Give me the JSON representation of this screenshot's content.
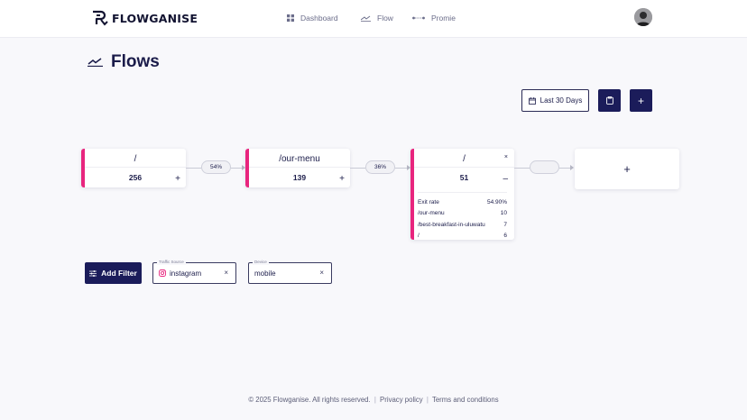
{
  "brand": {
    "name": "FLOWGANISE"
  },
  "nav": {
    "items": [
      {
        "label": "Dashboard",
        "icon": "grid-icon"
      },
      {
        "label": "Flow",
        "icon": "flow-icon"
      },
      {
        "label": "Promie",
        "icon": "dots-line-icon"
      }
    ]
  },
  "page": {
    "title": "Flows"
  },
  "toolbar": {
    "date_range": "Last 30 Days",
    "copy_icon": "clipboard-icon",
    "add_label": "+"
  },
  "flow": {
    "steps": [
      {
        "path": "/",
        "count": "256",
        "action": "+"
      },
      {
        "path": "/our-menu",
        "count": "139",
        "action": "+"
      },
      {
        "path": "/",
        "count": "51",
        "action": "–",
        "close": "×",
        "details": [
          {
            "label": "Exit rate",
            "value": "54.90%"
          },
          {
            "label": "/our-menu",
            "value": "10"
          },
          {
            "label": "/best-breakfast-in-uluwatu",
            "value": "7"
          },
          {
            "label": "/",
            "value": "6"
          }
        ]
      }
    ],
    "transitions": [
      "54%",
      "36%",
      ""
    ],
    "add_step_label": "+"
  },
  "filters": {
    "add_label": "Add Filter",
    "chips": [
      {
        "label": "Traffic Source",
        "value": "instagram",
        "icon": "instagram-icon",
        "remove": "×"
      },
      {
        "label": "Device",
        "value": "mobile",
        "remove": "×"
      }
    ]
  },
  "footer": {
    "copyright": "© 2025 Flowganise. All rights reserved.",
    "privacy": "Privacy policy",
    "terms": "Terms and conditions"
  },
  "colors": {
    "accent": "#e8257e",
    "primary": "#1b1c5a",
    "background": "#f8f8fb"
  }
}
